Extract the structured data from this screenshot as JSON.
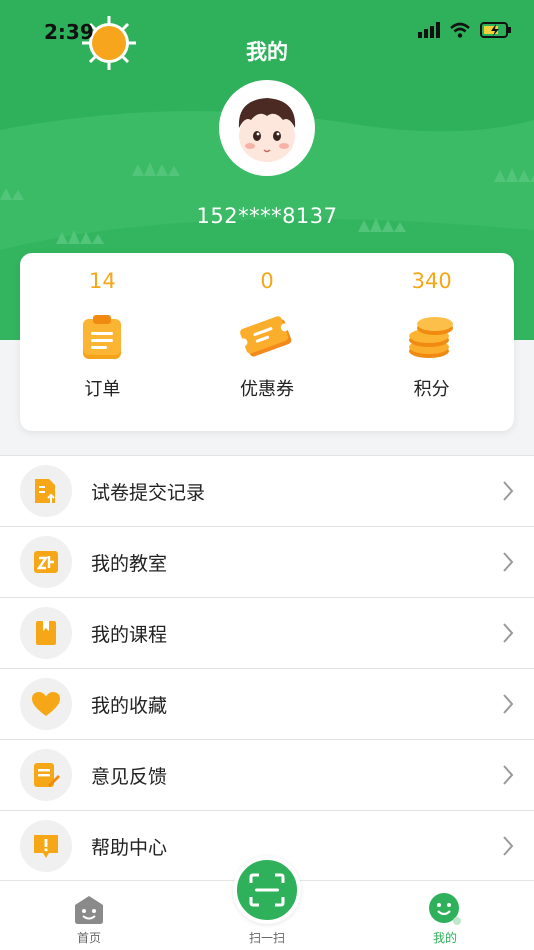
{
  "status_bar": {
    "time": "2:39"
  },
  "header": {
    "title": "我的",
    "phone": "152****8137"
  },
  "stats": [
    {
      "value": "14",
      "label": "订单",
      "icon": "clipboard-icon"
    },
    {
      "value": "0",
      "label": "优惠券",
      "icon": "coupon-icon"
    },
    {
      "value": "340",
      "label": "积分",
      "icon": "coins-icon"
    }
  ],
  "menu": [
    {
      "label": "试卷提交记录",
      "icon": "exam-upload-icon"
    },
    {
      "label": "我的教室",
      "icon": "classroom-icon"
    },
    {
      "label": "我的课程",
      "icon": "book-icon"
    },
    {
      "label": "我的收藏",
      "icon": "heart-icon"
    },
    {
      "label": "意见反馈",
      "icon": "feedback-icon"
    },
    {
      "label": "帮助中心",
      "icon": "help-icon"
    }
  ],
  "tabbar": {
    "home": "首页",
    "scan": "扫一扫",
    "me": "我的"
  },
  "colors": {
    "brand_green": "#2fb05a",
    "accent_orange": "#f6a717"
  }
}
